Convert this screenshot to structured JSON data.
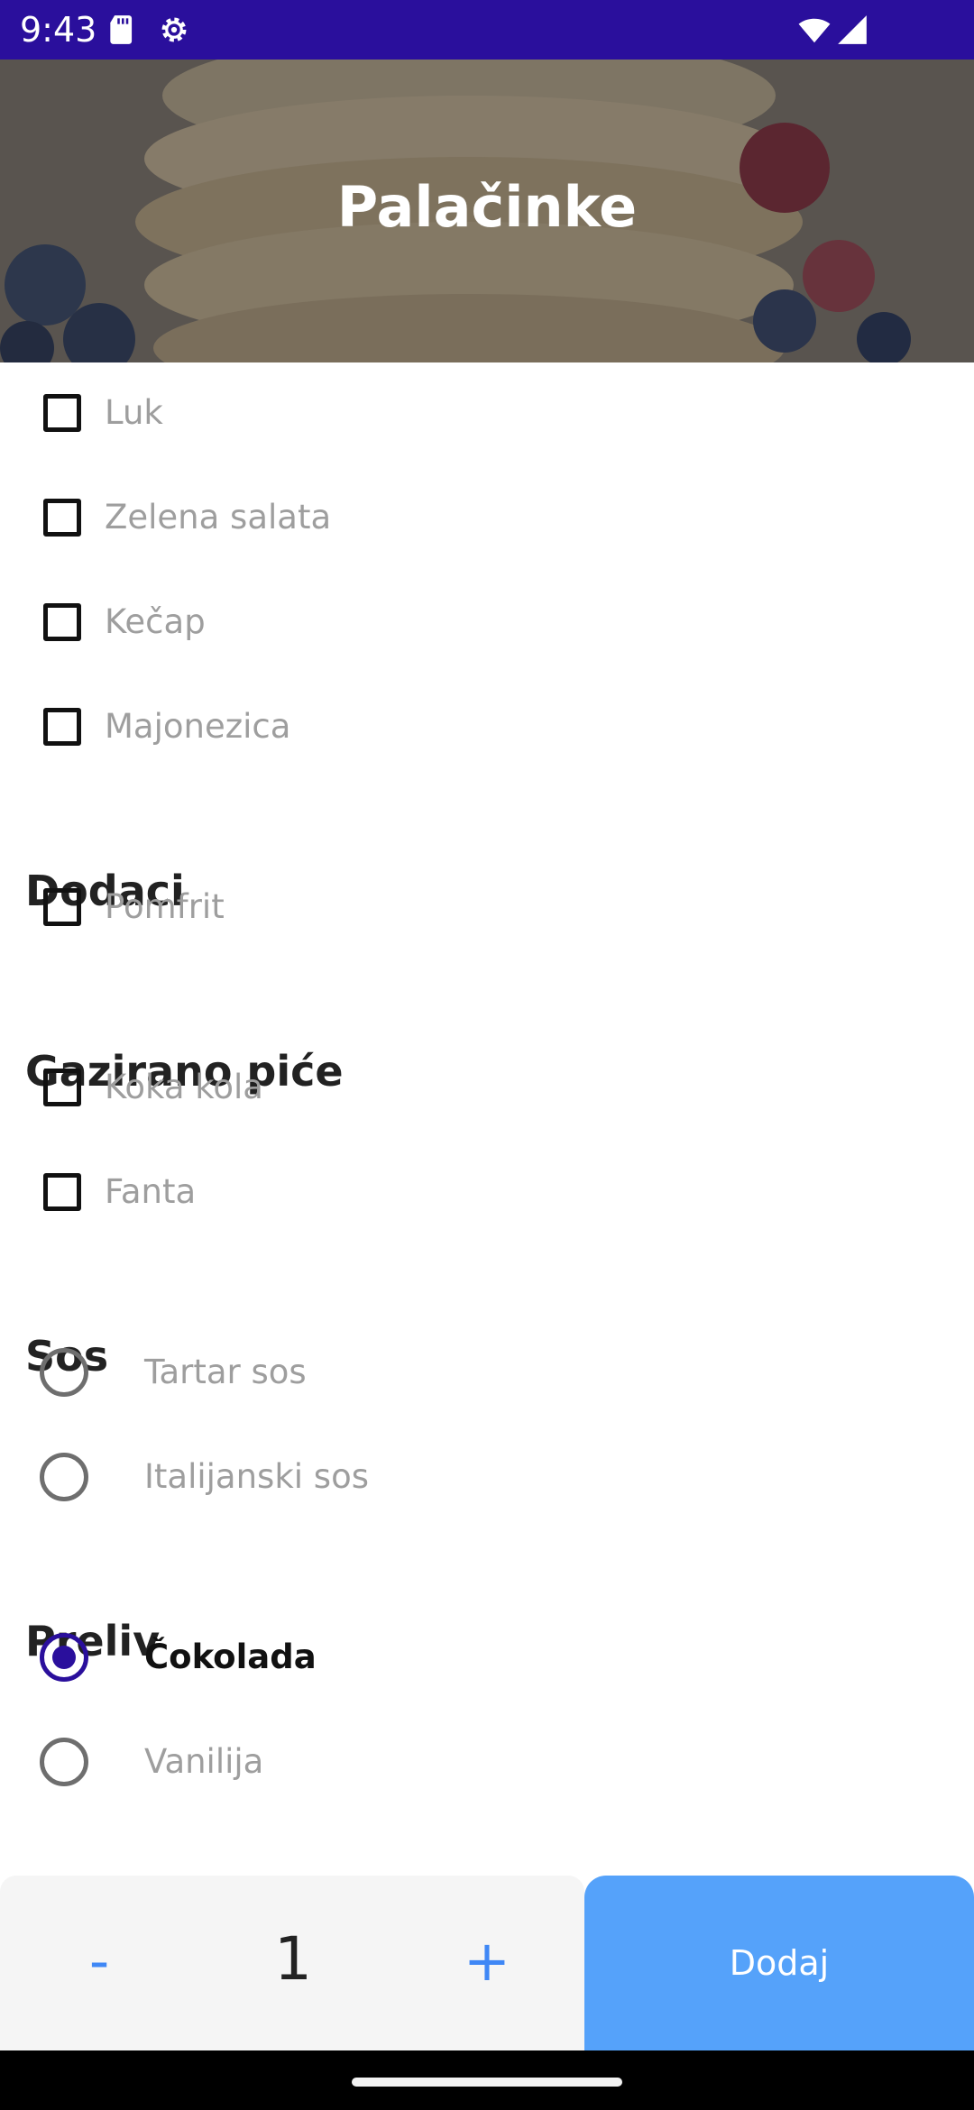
{
  "status_bar": {
    "time": "9:43",
    "icons": [
      "sd-card-icon",
      "settings-gear-icon",
      "wifi-icon",
      "cellular-signal-icon"
    ],
    "background_color": "#2a0f9c"
  },
  "header": {
    "title": "Palačinke"
  },
  "sections": {
    "extras": {
      "items": [
        "Luk",
        "Zelena salata",
        "Kečap",
        "Majonezica"
      ]
    },
    "dodaci": {
      "title": "Dodaci",
      "items": [
        "Pomfrit"
      ]
    },
    "gazirano": {
      "title": "Gazirano piće",
      "items": [
        "Koka kola",
        "Fanta"
      ]
    },
    "sos": {
      "title": "Sos",
      "options": [
        "Tartar sos",
        "Italijanski sos"
      ]
    },
    "preliv": {
      "title": "Preliv",
      "options": [
        "Čokolada",
        "Vanilija"
      ],
      "selected": "Čokolada"
    }
  },
  "quantity": {
    "minus": "-",
    "value": "1",
    "plus": "+"
  },
  "add_button": {
    "label": "Dodaj",
    "color": "#55a2fa"
  },
  "accent_color": "#2a0f9c"
}
